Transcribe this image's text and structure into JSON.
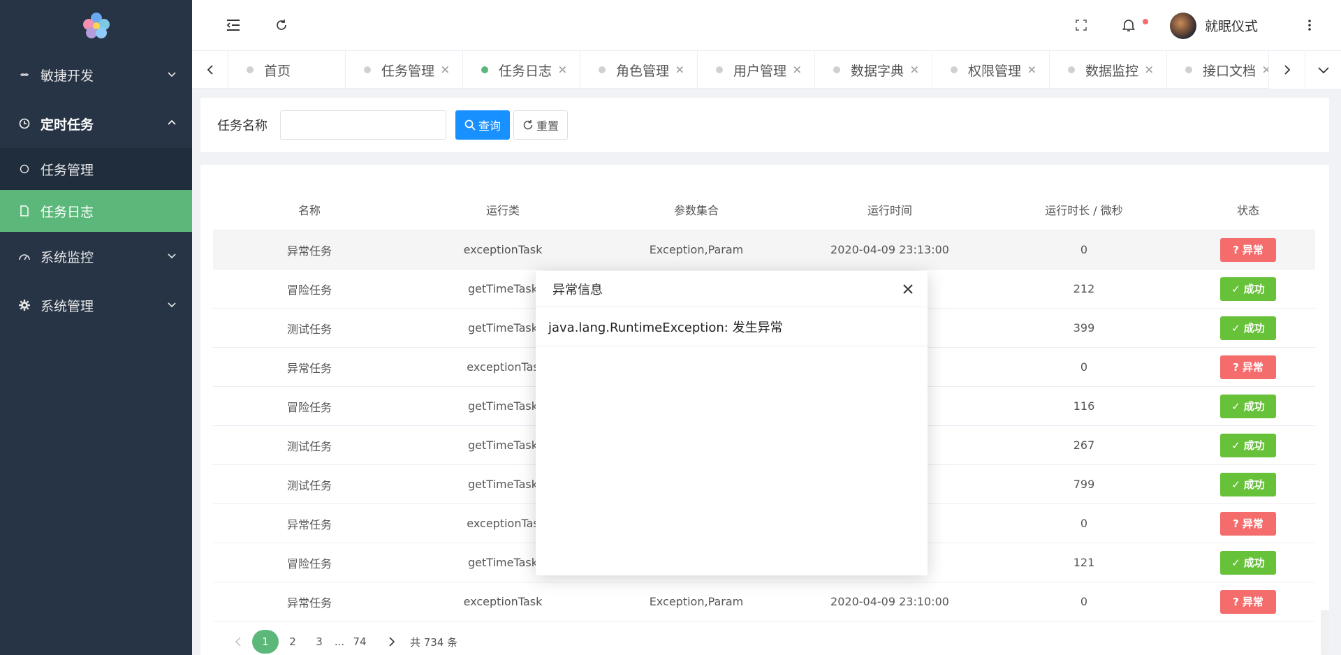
{
  "sidebar": {
    "items": [
      {
        "label": "敏捷开发"
      },
      {
        "label": "定时任务"
      },
      {
        "label": "系统监控"
      },
      {
        "label": "系统管理"
      }
    ],
    "submenu": [
      {
        "label": "任务管理"
      },
      {
        "label": "任务日志"
      }
    ]
  },
  "header": {
    "user_name": "就眠仪式"
  },
  "tabs": [
    {
      "label": "首页"
    },
    {
      "label": "任务管理"
    },
    {
      "label": "任务日志"
    },
    {
      "label": "角色管理"
    },
    {
      "label": "用户管理"
    },
    {
      "label": "数据字典"
    },
    {
      "label": "权限管理"
    },
    {
      "label": "数据监控"
    },
    {
      "label": "接口文档"
    }
  ],
  "search": {
    "label": "任务名称",
    "value": "",
    "query_label": "查询",
    "reset_label": "重置"
  },
  "table": {
    "headers": [
      "名称",
      "运行类",
      "参数集合",
      "运行时间",
      "运行时长 / 微秒",
      "状态"
    ],
    "rows": [
      {
        "name": "异常任务",
        "cls": "exceptionTask",
        "params": "Exception,Param",
        "time": "2020-04-09 23:13:00",
        "dur": "0",
        "status": "异常",
        "ok": false
      },
      {
        "name": "冒险任务",
        "cls": "getTimeTask",
        "params": "",
        "time": ":00",
        "dur": "212",
        "status": "成功",
        "ok": true
      },
      {
        "name": "测试任务",
        "cls": "getTimeTask",
        "params": "",
        "time": ":00",
        "dur": "399",
        "status": "成功",
        "ok": true
      },
      {
        "name": "异常任务",
        "cls": "exceptionTas",
        "params": "",
        "time": ":00",
        "dur": "0",
        "status": "异常",
        "ok": false
      },
      {
        "name": "冒险任务",
        "cls": "getTimeTask",
        "params": "",
        "time": ":00",
        "dur": "116",
        "status": "成功",
        "ok": true
      },
      {
        "name": "测试任务",
        "cls": "getTimeTask",
        "params": "",
        "time": ":00",
        "dur": "267",
        "status": "成功",
        "ok": true
      },
      {
        "name": "测试任务",
        "cls": "getTimeTask",
        "params": "",
        "time": ":00",
        "dur": "799",
        "status": "成功",
        "ok": true
      },
      {
        "name": "异常任务",
        "cls": "exceptionTas",
        "params": "",
        "time": ":00",
        "dur": "0",
        "status": "异常",
        "ok": false
      },
      {
        "name": "冒险任务",
        "cls": "getTimeTask",
        "params": "",
        "time": ":00",
        "dur": "121",
        "status": "成功",
        "ok": true
      },
      {
        "name": "异常任务",
        "cls": "exceptionTask",
        "params": "Exception,Param",
        "time": "2020-04-09 23:10:00",
        "dur": "0",
        "status": "异常",
        "ok": false
      }
    ]
  },
  "pagination": {
    "pages": [
      "1",
      "2",
      "3",
      "...",
      "74"
    ],
    "total": "共 734 条"
  },
  "modal": {
    "title": "异常信息",
    "message": "java.lang.RuntimeException: 发生异常"
  },
  "colors": {
    "sidebar": "#263445",
    "active": "#5cb87a",
    "primary": "#1890ff",
    "success": "#67c23a",
    "danger": "#f56c6c"
  }
}
